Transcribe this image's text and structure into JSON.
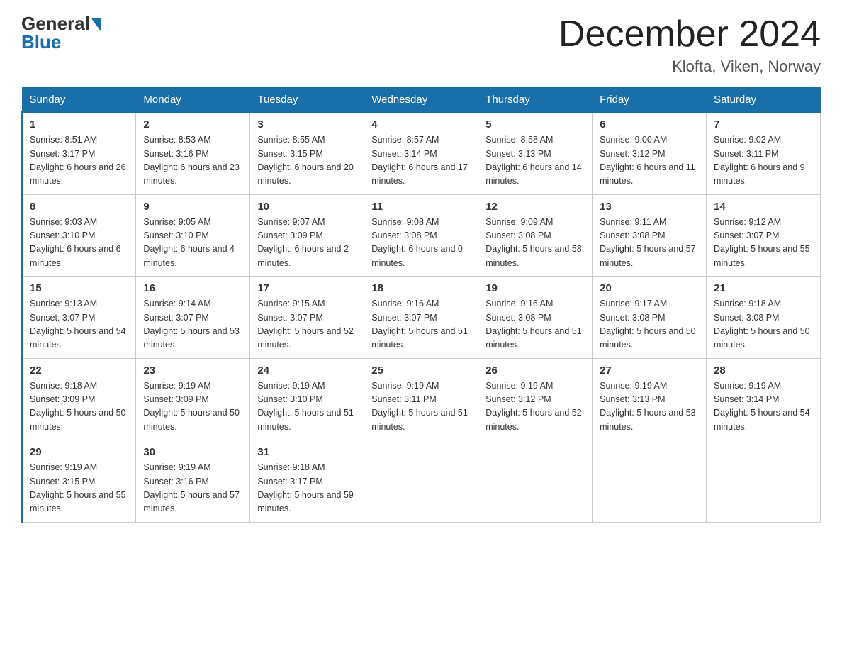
{
  "header": {
    "logo_general": "General",
    "logo_blue": "Blue",
    "title": "December 2024",
    "subtitle": "Klofta, Viken, Norway"
  },
  "weekdays": [
    "Sunday",
    "Monday",
    "Tuesday",
    "Wednesday",
    "Thursday",
    "Friday",
    "Saturday"
  ],
  "weeks": [
    [
      {
        "day": "1",
        "sunrise": "8:51 AM",
        "sunset": "3:17 PM",
        "daylight": "6 hours and 26 minutes."
      },
      {
        "day": "2",
        "sunrise": "8:53 AM",
        "sunset": "3:16 PM",
        "daylight": "6 hours and 23 minutes."
      },
      {
        "day": "3",
        "sunrise": "8:55 AM",
        "sunset": "3:15 PM",
        "daylight": "6 hours and 20 minutes."
      },
      {
        "day": "4",
        "sunrise": "8:57 AM",
        "sunset": "3:14 PM",
        "daylight": "6 hours and 17 minutes."
      },
      {
        "day": "5",
        "sunrise": "8:58 AM",
        "sunset": "3:13 PM",
        "daylight": "6 hours and 14 minutes."
      },
      {
        "day": "6",
        "sunrise": "9:00 AM",
        "sunset": "3:12 PM",
        "daylight": "6 hours and 11 minutes."
      },
      {
        "day": "7",
        "sunrise": "9:02 AM",
        "sunset": "3:11 PM",
        "daylight": "6 hours and 9 minutes."
      }
    ],
    [
      {
        "day": "8",
        "sunrise": "9:03 AM",
        "sunset": "3:10 PM",
        "daylight": "6 hours and 6 minutes."
      },
      {
        "day": "9",
        "sunrise": "9:05 AM",
        "sunset": "3:10 PM",
        "daylight": "6 hours and 4 minutes."
      },
      {
        "day": "10",
        "sunrise": "9:07 AM",
        "sunset": "3:09 PM",
        "daylight": "6 hours and 2 minutes."
      },
      {
        "day": "11",
        "sunrise": "9:08 AM",
        "sunset": "3:08 PM",
        "daylight": "6 hours and 0 minutes."
      },
      {
        "day": "12",
        "sunrise": "9:09 AM",
        "sunset": "3:08 PM",
        "daylight": "5 hours and 58 minutes."
      },
      {
        "day": "13",
        "sunrise": "9:11 AM",
        "sunset": "3:08 PM",
        "daylight": "5 hours and 57 minutes."
      },
      {
        "day": "14",
        "sunrise": "9:12 AM",
        "sunset": "3:07 PM",
        "daylight": "5 hours and 55 minutes."
      }
    ],
    [
      {
        "day": "15",
        "sunrise": "9:13 AM",
        "sunset": "3:07 PM",
        "daylight": "5 hours and 54 minutes."
      },
      {
        "day": "16",
        "sunrise": "9:14 AM",
        "sunset": "3:07 PM",
        "daylight": "5 hours and 53 minutes."
      },
      {
        "day": "17",
        "sunrise": "9:15 AM",
        "sunset": "3:07 PM",
        "daylight": "5 hours and 52 minutes."
      },
      {
        "day": "18",
        "sunrise": "9:16 AM",
        "sunset": "3:07 PM",
        "daylight": "5 hours and 51 minutes."
      },
      {
        "day": "19",
        "sunrise": "9:16 AM",
        "sunset": "3:08 PM",
        "daylight": "5 hours and 51 minutes."
      },
      {
        "day": "20",
        "sunrise": "9:17 AM",
        "sunset": "3:08 PM",
        "daylight": "5 hours and 50 minutes."
      },
      {
        "day": "21",
        "sunrise": "9:18 AM",
        "sunset": "3:08 PM",
        "daylight": "5 hours and 50 minutes."
      }
    ],
    [
      {
        "day": "22",
        "sunrise": "9:18 AM",
        "sunset": "3:09 PM",
        "daylight": "5 hours and 50 minutes."
      },
      {
        "day": "23",
        "sunrise": "9:19 AM",
        "sunset": "3:09 PM",
        "daylight": "5 hours and 50 minutes."
      },
      {
        "day": "24",
        "sunrise": "9:19 AM",
        "sunset": "3:10 PM",
        "daylight": "5 hours and 51 minutes."
      },
      {
        "day": "25",
        "sunrise": "9:19 AM",
        "sunset": "3:11 PM",
        "daylight": "5 hours and 51 minutes."
      },
      {
        "day": "26",
        "sunrise": "9:19 AM",
        "sunset": "3:12 PM",
        "daylight": "5 hours and 52 minutes."
      },
      {
        "day": "27",
        "sunrise": "9:19 AM",
        "sunset": "3:13 PM",
        "daylight": "5 hours and 53 minutes."
      },
      {
        "day": "28",
        "sunrise": "9:19 AM",
        "sunset": "3:14 PM",
        "daylight": "5 hours and 54 minutes."
      }
    ],
    [
      {
        "day": "29",
        "sunrise": "9:19 AM",
        "sunset": "3:15 PM",
        "daylight": "5 hours and 55 minutes."
      },
      {
        "day": "30",
        "sunrise": "9:19 AM",
        "sunset": "3:16 PM",
        "daylight": "5 hours and 57 minutes."
      },
      {
        "day": "31",
        "sunrise": "9:18 AM",
        "sunset": "3:17 PM",
        "daylight": "5 hours and 59 minutes."
      },
      null,
      null,
      null,
      null
    ]
  ]
}
